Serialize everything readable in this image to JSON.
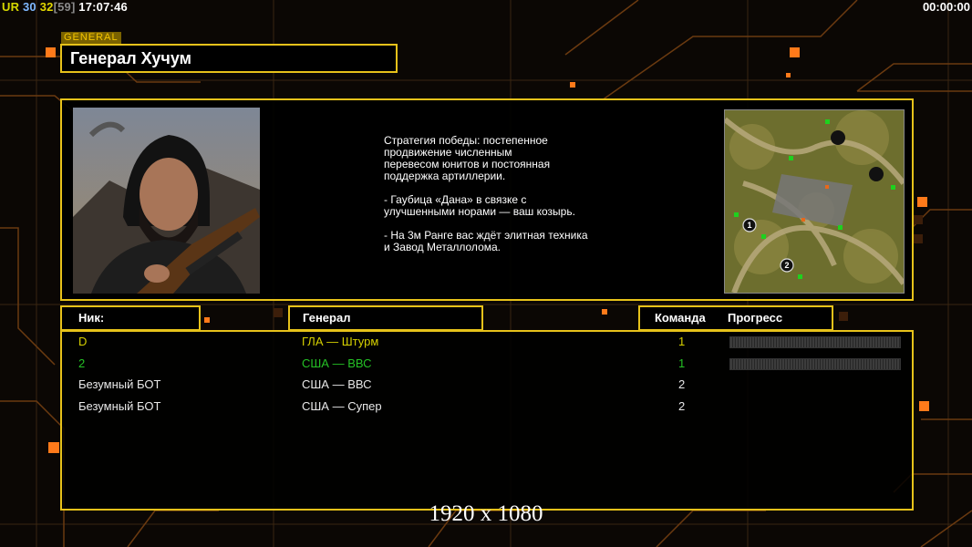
{
  "hud": {
    "ur": "UR",
    "num1": "30",
    "num2": "32",
    "num3": "[59]",
    "clock": "17:07:46",
    "timer": "00:00:00"
  },
  "general": {
    "tag": "GENERAL",
    "name": "Генерал Хучум"
  },
  "description": [
    "Стратегия победы: постепенное\nпродвижение численным\nперевесом юнитов и постоянная\nподдержка артиллерии.",
    "- Гаубица «Дана» в связке с\nулучшенными норами — ваш козырь.",
    "- На 3м Ранге вас ждёт элитная техника\nи Завод Металлолома."
  ],
  "columns": {
    "nick": "Ник:",
    "general": "Генерал",
    "team": "Команда",
    "progress": "Прогресс"
  },
  "players": [
    {
      "nick": "D",
      "general": "ГЛА — Штурм",
      "team": "1",
      "color": "#d6d000",
      "progress": 0
    },
    {
      "nick": "2",
      "general": "США — ВВС",
      "team": "1",
      "color": "#25c125",
      "progress": 0
    },
    {
      "nick": "Безумный БОТ",
      "general": "США — ВВС",
      "team": "2",
      "color": "#ffffff"
    },
    {
      "nick": "Безумный БОТ",
      "general": "США — Супер",
      "team": "2",
      "color": "#ffffff"
    }
  ],
  "minimap": {
    "start_markers": [
      "1",
      "2"
    ]
  },
  "resolution_label": "1920 x 1080",
  "colors": {
    "frame": "#e7c21a",
    "accent": "#ff7a00",
    "gla": "#d6d000",
    "usa": "#25c125"
  }
}
